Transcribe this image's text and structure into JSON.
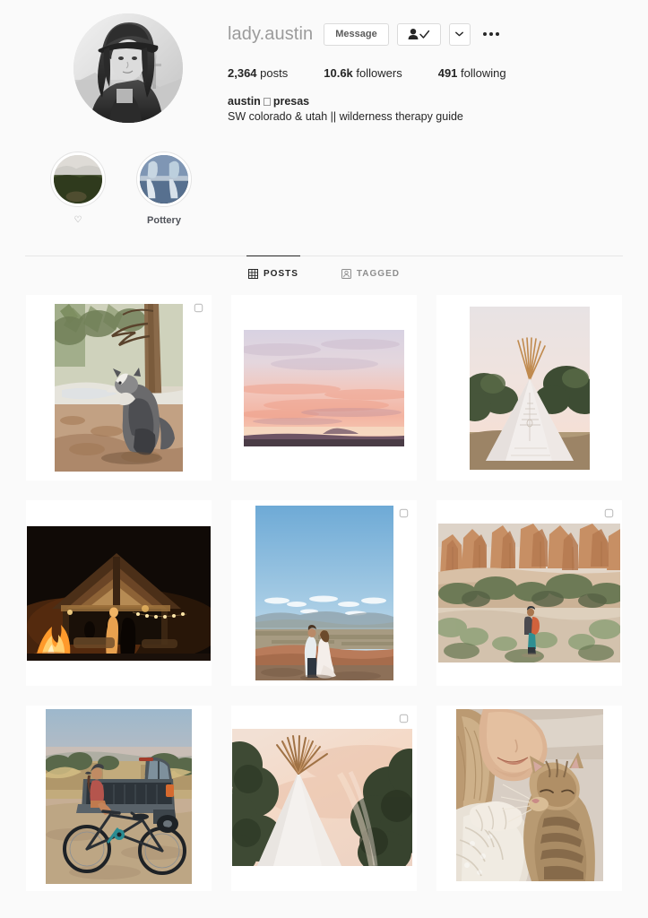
{
  "profile": {
    "username": "lady.austin",
    "display_name": "austin",
    "display_name_suffix": "presas",
    "bio": "SW colorado & utah || wilderness therapy guide",
    "avatar_alt": "profile-photo-black-and-white-portrait"
  },
  "actions": {
    "message_label": "Message",
    "following_icon": "person-check-icon",
    "caret_icon": "chevron-down-icon",
    "options_icon": "more-options-icon"
  },
  "stats": [
    {
      "num": "2,364",
      "label": "posts"
    },
    {
      "num": "10.6k",
      "label": "followers"
    },
    {
      "num": "491",
      "label": "following"
    }
  ],
  "highlights": [
    {
      "label": "♡",
      "is_heart": true,
      "cover": "forest-landscape"
    },
    {
      "label": "Pottery",
      "is_heart": false,
      "cover": "pottery-hands-blue"
    }
  ],
  "tabs": [
    {
      "label": "POSTS",
      "icon": "grid-icon",
      "active": true
    },
    {
      "label": "TAGGED",
      "icon": "tag-person-icon",
      "active": false
    }
  ],
  "posts": [
    {
      "alt": "dog-sitting-in-pine-forest",
      "orientation": "portrait",
      "multi": true
    },
    {
      "alt": "pink-purple-sunset-over-desert-horizon",
      "orientation": "landscape",
      "multi": false
    },
    {
      "alt": "white-teepee-tent-at-dusk-with-trees",
      "orientation": "portrait",
      "multi": false
    },
    {
      "alt": "night-campfire-at-wooden-cabin-with-string-lights",
      "orientation": "landscape",
      "multi": false
    },
    {
      "alt": "wedding-couple-on-canyon-overlook-blue-sky",
      "orientation": "portrait",
      "multi": true
    },
    {
      "alt": "hiker-with-red-backpack-in-red-rock-desert",
      "orientation": "landscape",
      "multi": true
    },
    {
      "alt": "woman-in-truck-bed-with-mountain-bike-at-dusk",
      "orientation": "portrait",
      "multi": false
    },
    {
      "alt": "teepee-poles-against-pink-sky-framed-by-trees",
      "orientation": "landscape",
      "multi": true
    },
    {
      "alt": "woman-nose-to-nose-with-tabby-cat",
      "orientation": "portrait",
      "multi": false
    }
  ],
  "colors": {
    "page_background": "#fafafa",
    "card_background": "#ffffff",
    "text_primary": "#262626",
    "text_secondary": "#8e8e8e",
    "username_color": "#9b9b9b",
    "border": "#dbdbdb"
  }
}
